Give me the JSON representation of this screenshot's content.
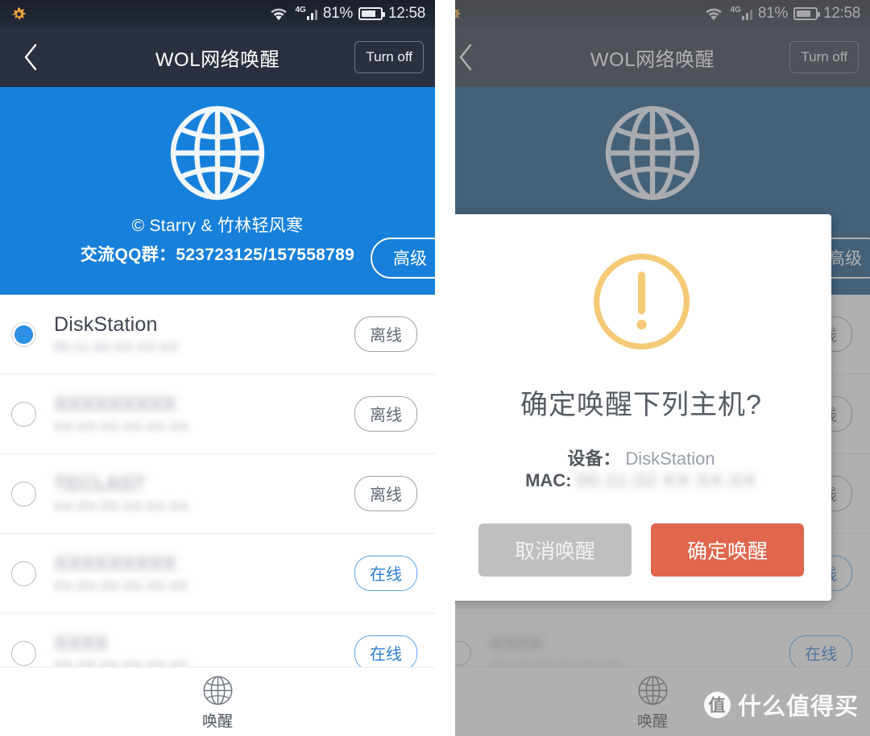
{
  "statusbar": {
    "gear_icon": "gear-icon",
    "wifi_icon": "wifi-icon",
    "network_label": "4G",
    "signal_icon": "signal-bars-icon",
    "battery_percent": "81%",
    "battery_icon": "battery-icon",
    "clock": "12:58"
  },
  "navbar": {
    "back_icon": "chevron-left-icon",
    "title": "WOL网络唤醒",
    "action_label": "Turn off"
  },
  "hero": {
    "globe_icon": "globe-icon",
    "credit": "© Starry & 竹林轻风寒",
    "qq": "交流QQ群：523723125/157558789",
    "advanced_label": "高级",
    "bg_color": "#1680db",
    "bg_color_dimmed": "#115083"
  },
  "list": {
    "rows": [
      {
        "name": "DiskStation",
        "mac": "00:11:32:XX:XX:XX",
        "status": "离线",
        "online": false,
        "selected": true,
        "blurred": false
      },
      {
        "name": "XXXXXXXXX",
        "mac": "XX:XX:XX:XX:XX:XX",
        "status": "离线",
        "online": false,
        "selected": false,
        "blurred": true
      },
      {
        "name": "TECLAST",
        "mac": "XX:XX:XX:XX:XX:XX",
        "status": "离线",
        "online": false,
        "selected": false,
        "blurred": true
      },
      {
        "name": "XXXXXXXXX",
        "mac": "XX:XX:XX:XX:XX:XX",
        "status": "在线",
        "online": true,
        "selected": false,
        "blurred": true
      },
      {
        "name": "XXXX",
        "mac": "XX:XX:XX:XX:XX:XX",
        "status": "在线",
        "online": true,
        "selected": false,
        "blurred": true
      }
    ]
  },
  "tabbar": {
    "wake_icon": "globe-icon",
    "wake_label": "唤醒"
  },
  "modal": {
    "warning_icon": "warning-exclamation-icon",
    "title": "确定唤醒下列主机?",
    "device_key": "设备：",
    "device_value": "DiskStation",
    "mac_key": "MAC:",
    "mac_value": "00:11:32:XX:XX:XX",
    "cancel_label": "取消唤醒",
    "confirm_label": "确定唤醒",
    "cancel_color": "#bfbfbf",
    "confirm_color": "#e0674d",
    "warning_color": "#f5ca77"
  },
  "watermark": {
    "badge": "值",
    "text": "什么值得买"
  }
}
